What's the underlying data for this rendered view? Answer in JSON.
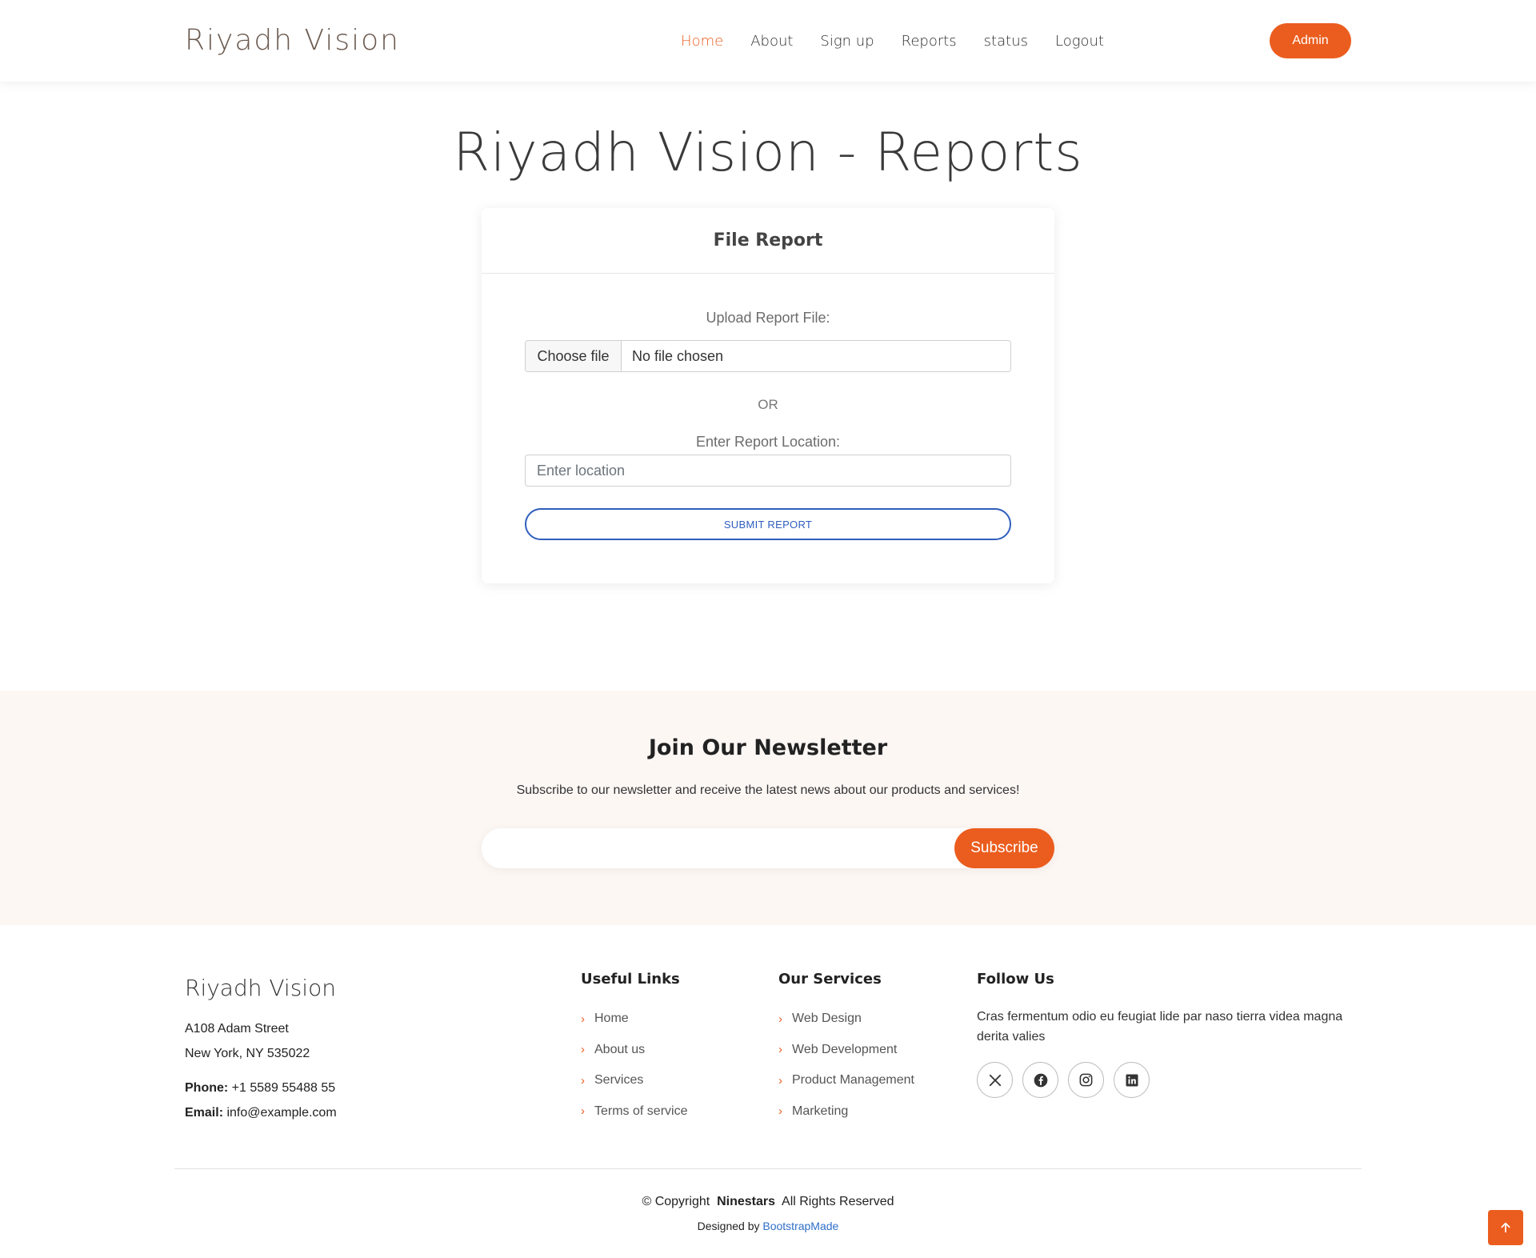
{
  "header": {
    "logo": "Riyadh Vision",
    "nav": [
      "Home",
      "About",
      "Sign up",
      "Reports",
      "status",
      "Logout"
    ],
    "admin_label": "Admin"
  },
  "page": {
    "title": "Riyadh Vision - Reports"
  },
  "report_form": {
    "title": "File Report",
    "upload_label": "Upload Report File:",
    "choose_file": "Choose file",
    "file_status": "No file chosen",
    "or": "OR",
    "location_label": "Enter Report Location:",
    "location_placeholder": "Enter location",
    "location_value": "",
    "submit": "SUBMIT REPORT"
  },
  "newsletter": {
    "title": "Join Our Newsletter",
    "text": "Subscribe to our newsletter and receive the latest news about our products and services!",
    "email_value": "",
    "button": "Subscribe"
  },
  "footer": {
    "logo": "Riyadh Vision",
    "address_line1": "A108 Adam Street",
    "address_line2": "New York, NY 535022",
    "phone_label": "Phone:",
    "phone": "+1 5589 55488 55",
    "email_label": "Email:",
    "email": "info@example.com",
    "useful_links_title": "Useful Links",
    "useful_links": [
      "Home",
      "About us",
      "Services",
      "Terms of service"
    ],
    "services_title": "Our Services",
    "services": [
      "Web Design",
      "Web Development",
      "Product Management",
      "Marketing"
    ],
    "follow_title": "Follow Us",
    "follow_text": "Cras fermentum odio eu feugiat lide par naso tierra videa magna derita valies",
    "socials": [
      "x-icon",
      "facebook-icon",
      "instagram-icon",
      "linkedin-icon"
    ],
    "copyright_prefix": "© Copyright",
    "company": "Ninestars",
    "rights": "All Rights Reserved",
    "designed_by": "Designed by",
    "designer": "BootstrapMade"
  },
  "colors": {
    "accent": "#eb5d1e",
    "link_blue": "#2f5ebd",
    "newsletter_bg": "#fdf7f4"
  }
}
